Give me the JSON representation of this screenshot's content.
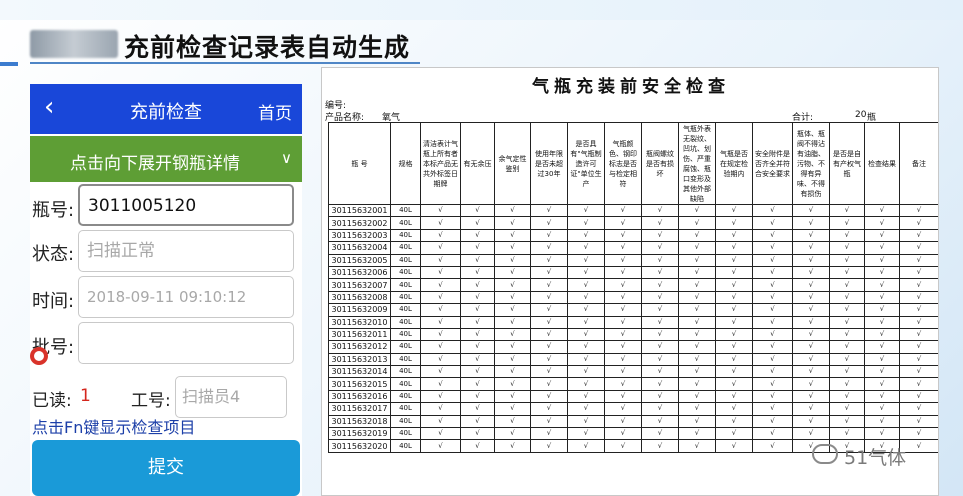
{
  "slide": {
    "title": "充前检查记录表自动生成"
  },
  "phone": {
    "back_icon": "chevron-left-icon",
    "title": "充前检查",
    "home_label": "首页",
    "expand_label": "点击向下展开钢瓶详情",
    "chevron_icon": "chevron-down-icon",
    "fields": [
      {
        "label": "瓶号:",
        "value": "3011005120",
        "placeholder": ""
      },
      {
        "label": "状态:",
        "value": "",
        "placeholder": "扫描正常"
      },
      {
        "label": "时间:",
        "value": "",
        "placeholder": "2018-09-11 09:10:12"
      },
      {
        "label": "批号:",
        "value": "",
        "placeholder": ""
      }
    ],
    "read_label": "已读:",
    "read_value": "1",
    "work_label": "工号:",
    "work_placeholder": "扫描员4",
    "fn_hint": "点击Fn键显示检查项目",
    "submit_label": "提交"
  },
  "sheet": {
    "title": "气瓶充装前安全检查",
    "serial_label": "编号:",
    "product_label": "产品名称:",
    "product_value": "氧气",
    "total_label": "合计:",
    "total_value": "20",
    "total_unit": "瓶",
    "columns": [
      "瓶  号",
      "规格",
      "清洁表计气瓶上所有者本标产品无共外标签日期牌",
      "有无余压",
      "余气定性鉴别",
      "使用年限是否未超过30年",
      "是否具有\"气瓶制造许可证\"单位生产",
      "气瓶颜色、钢印标志是否与检定相符",
      "瓶阀螺纹是否有损坏",
      "气瓶外表无裂纹、凹坑、划伤、严重腐蚀、瓶口变形及其他外部缺陷",
      "气瓶是否在规定检验期内",
      "安全附件是否齐全并符合安全要求",
      "瓶体、瓶阀不得沾有油脂、污物、不得有异味、不得有损伤",
      "是否是自有产权气瓶",
      "检查结果",
      "备注"
    ],
    "spec": "40L",
    "check": "√",
    "rows": [
      "30115632001",
      "30115632002",
      "30115632003",
      "30115632004",
      "30115632005",
      "30115632006",
      "30115632007",
      "30115632008",
      "30115632009",
      "30115632010",
      "30115632011",
      "30115632012",
      "30115632013",
      "30115632014",
      "30115632015",
      "30115632016",
      "30115632017",
      "30115632018",
      "30115632019",
      "30115632020"
    ]
  },
  "watermark": {
    "icon": "wechat-icon",
    "text": "51气体"
  }
}
